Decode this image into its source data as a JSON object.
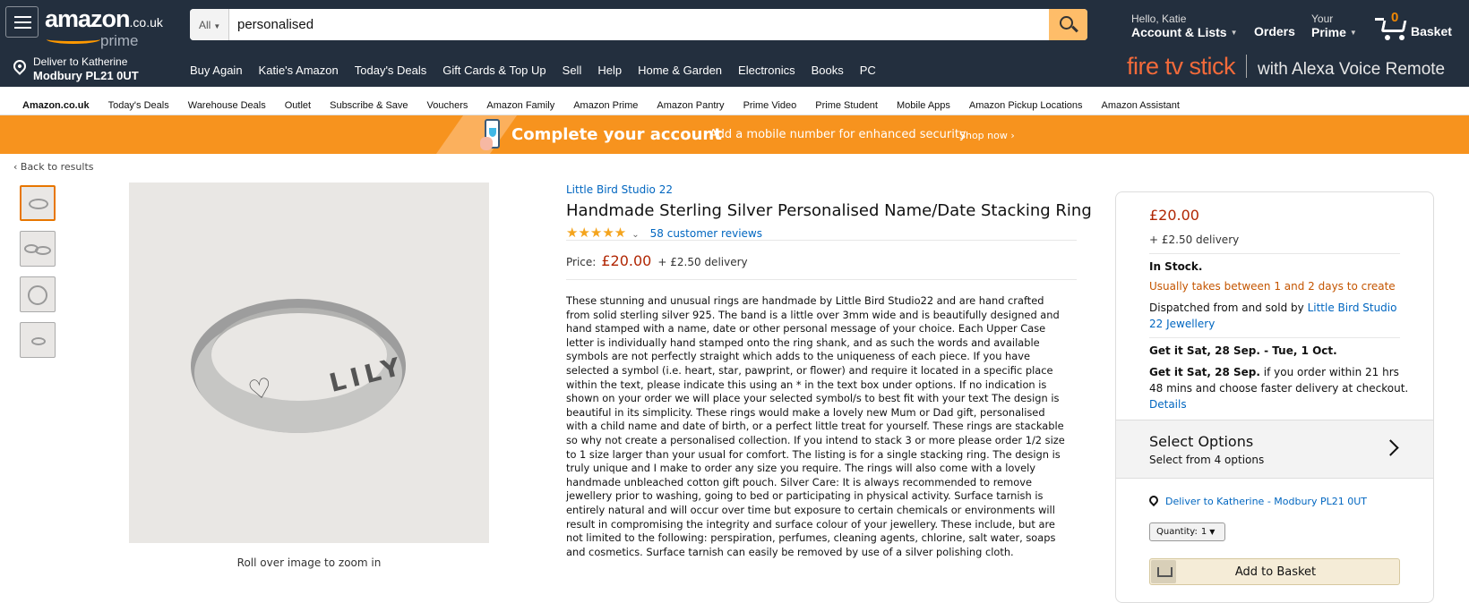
{
  "header": {
    "logo_word": "amazon",
    "logo_tld": ".co.uk",
    "logo_prime": "prime",
    "search_category": "All",
    "search_value": "personalised",
    "greeting": "Hello, Katie",
    "account_label": "Account & Lists",
    "orders_label": "Orders",
    "your_label": "Your",
    "prime_label": "Prime",
    "basket_count": "0",
    "basket_label": "Basket"
  },
  "deliver": {
    "line1": "Deliver to Katherine",
    "line2": "Modbury PL21 0UT"
  },
  "nav_links": [
    "Buy Again",
    "Katie's Amazon",
    "Today's Deals",
    "Gift Cards & Top Up",
    "Sell",
    "Help",
    "Home & Garden",
    "Electronics",
    "Books",
    "PC"
  ],
  "promo": {
    "brand": "fire tv stick",
    "tagline": "with Alexa Voice Remote"
  },
  "sub_nav": [
    "Amazon.co.uk",
    "Today's Deals",
    "Warehouse Deals",
    "Outlet",
    "Subscribe & Save",
    "Vouchers",
    "Amazon Family",
    "Amazon Prime",
    "Amazon Pantry",
    "Prime Video",
    "Prime Student",
    "Mobile Apps",
    "Amazon Pickup Locations",
    "Amazon Assistant"
  ],
  "banner": {
    "title": "Complete your account",
    "subtitle": "Add a mobile number for enhanced security",
    "cta": "Shop now ›"
  },
  "product": {
    "back_link": "‹ Back to results",
    "ring_engraving": "LILY",
    "zoom_hint": "Roll over image to zoom in",
    "store": "Little Bird Studio 22",
    "title": "Handmade Sterling Silver Personalised Name/Date Stacking Ring",
    "stars": "★★★★★",
    "rating": 5,
    "reviews": "58 customer reviews",
    "price_label": "Price:",
    "price": "£20.00",
    "delivery": "+ £2.50 delivery",
    "description": "These stunning and unusual rings are handmade by Little Bird Studio22 and are hand crafted from solid sterling silver 925. The band is a little over 3mm wide and is beautifully designed and hand stamped with a name, date or other personal message of your choice. Each Upper Case letter is individually hand stamped onto the ring shank, and as such the words and available symbols are not perfectly straight which adds to the uniqueness of each piece. If you have selected a symbol (i.e. heart, star, pawprint, or flower) and require it located in a specific place within the text, please indicate this using an * in the text box under options. If no indication is shown on your order we will place your selected symbol/s to best fit with your text The design is beautiful in its simplicity. These rings would make a lovely new Mum or Dad gift, personalised with a child name and date of birth, or a perfect little treat for yourself. These rings are stackable so why not create a personalised collection. If you intend to stack 3 or more please order 1/2 size to 1 size larger than your usual for comfort. The listing is for a single stacking ring. The design is truly unique and I make to order any size you require. The rings will also come with a lovely handmade unbleached cotton gift pouch. Silver Care: It is always recommended to remove jewellery prior to washing, going to bed or participating in physical activity. Surface tarnish is entirely natural and will occur over time but exposure to certain chemicals or environments will result in compromising the integrity and surface colour of your jewellery. These include, but are not limited to the following: perspiration, perfumes, cleaning agents, chlorine, salt water, soaps and cosmetics. Surface tarnish can easily be removed by use of a silver polishing cloth."
  },
  "buybox": {
    "price": "£20.00",
    "delivery": "+ £2.50 delivery",
    "stock": "In Stock.",
    "takes": "Usually takes between 1 and 2 days to create",
    "dispatched_prefix": "Dispatched from and sold by",
    "seller": "Little Bird Studio 22 Jewellery",
    "get_it": "Get it Sat, 28 Sep. - Tue, 1 Oct.",
    "get_it_bold": "Get it Sat, 28 Sep.",
    "get_it_rest": "if you order within 21 hrs 48 mins and choose faster delivery at checkout.",
    "details": "Details",
    "options_title": "Select Options",
    "options_sub": "Select from 4 options",
    "deliver_to": "Deliver to Katherine - Modbury PL21 0UT",
    "qty_label": "Quantity:",
    "qty_value": "1",
    "add_to_basket": "Add to Basket"
  },
  "colors": {
    "nav": "#232f3e",
    "banner": "#f7931e",
    "price": "#b12704",
    "link": "#0066c0",
    "orange_text": "#c45500"
  }
}
